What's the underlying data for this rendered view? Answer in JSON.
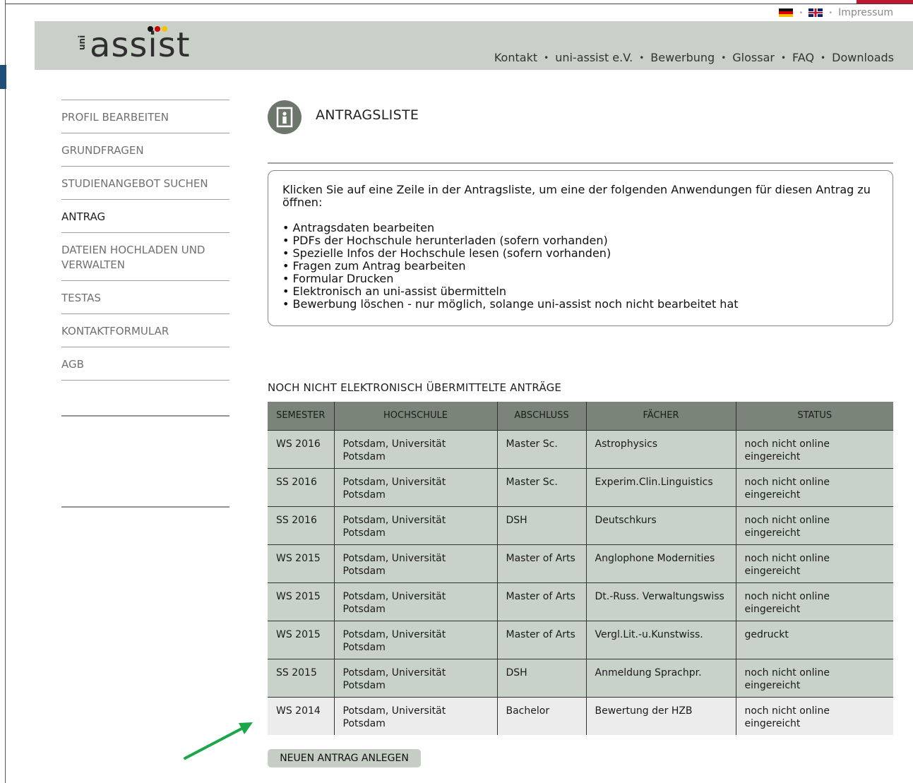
{
  "topbar": {
    "impressum": "Impressum"
  },
  "logo": {
    "uni": "uni",
    "main": "assist",
    "dot_colors": [
      "#111111",
      "#d00000",
      "#f4c300"
    ]
  },
  "nav": [
    "Kontakt",
    "uni-assist e.V.",
    "Bewerbung",
    "Glossar",
    "FAQ",
    "Downloads"
  ],
  "sidebar": {
    "items": [
      "PROFIL BEARBEITEN",
      "GRUNDFRAGEN",
      "STUDIENANGEBOT SUCHEN",
      "ANTRAG",
      "DATEIEN HOCHLADEN UND VERWALTEN",
      "TESTAS",
      "KONTAKTFORMULAR",
      "AGB"
    ],
    "active": "ANTRAG"
  },
  "page": {
    "title": "ANTRAGSLISTE",
    "icon": "door-person-icon"
  },
  "info": {
    "intro": "Klicken Sie auf eine Zeile in der Antragsliste, um eine der folgenden Anwendungen für diesen Antrag zu öffnen:",
    "items": [
      "• Antragsdaten bearbeiten",
      "• PDFs der Hochschule herunterladen (sofern vorhanden)",
      "• Spezielle Infos der Hochschule lesen (sofern vorhanden)",
      "• Fragen zum Antrag bearbeiten",
      "• Formular Drucken",
      "• Elektronisch an uni-assist übermitteln",
      "• Bewerbung löschen - nur möglich, solange uni-assist noch nicht bearbeitet hat"
    ]
  },
  "table": {
    "title": "NOCH NICHT ELEKTRONISCH ÜBERMITTELTE ANTRÄGE",
    "headers": [
      "SEMESTER",
      "HOCHSCHULE",
      "ABSCHLUSS",
      "FÄCHER",
      "STATUS"
    ],
    "rows": [
      [
        "WS 2016",
        "Potsdam, Universität Potsdam",
        "Master Sc.",
        "Astrophysics",
        "noch nicht online eingereicht"
      ],
      [
        "SS 2016",
        "Potsdam, Universität Potsdam",
        "Master Sc.",
        "Experim.Clin.Linguistics",
        "noch nicht online eingereicht"
      ],
      [
        "SS 2016",
        "Potsdam, Universität Potsdam",
        "DSH",
        "Deutschkurs",
        "noch nicht online eingereicht"
      ],
      [
        "WS 2015",
        "Potsdam, Universität Potsdam",
        "Master of Arts",
        "Anglophone Modernities",
        "noch nicht online eingereicht"
      ],
      [
        "WS 2015",
        "Potsdam, Universität Potsdam",
        "Master of Arts",
        "Dt.-Russ. Verwaltungswiss",
        "noch nicht online eingereicht"
      ],
      [
        "WS 2015",
        "Potsdam, Universität Potsdam",
        "Master of Arts",
        "Vergl.Lit.-u.Kunstwiss.",
        "gedruckt"
      ],
      [
        "SS 2015",
        "Potsdam, Universität Potsdam",
        "DSH",
        "Anmeldung Sprachpr.",
        "noch nicht online eingereicht"
      ],
      [
        "WS 2014",
        "Potsdam, Universität Potsdam",
        "Bachelor",
        "Bewertung der HZB",
        "noch nicht online eingereicht"
      ]
    ],
    "highlighted_row": 7
  },
  "button": {
    "new_label": "NEUEN ANTRAG ANLEGEN"
  },
  "colors": {
    "header_bg": "#c9d0c8",
    "table_head": "#7b8479",
    "row_bg": "#c9d2c8",
    "arrow": "#1aa64a"
  }
}
